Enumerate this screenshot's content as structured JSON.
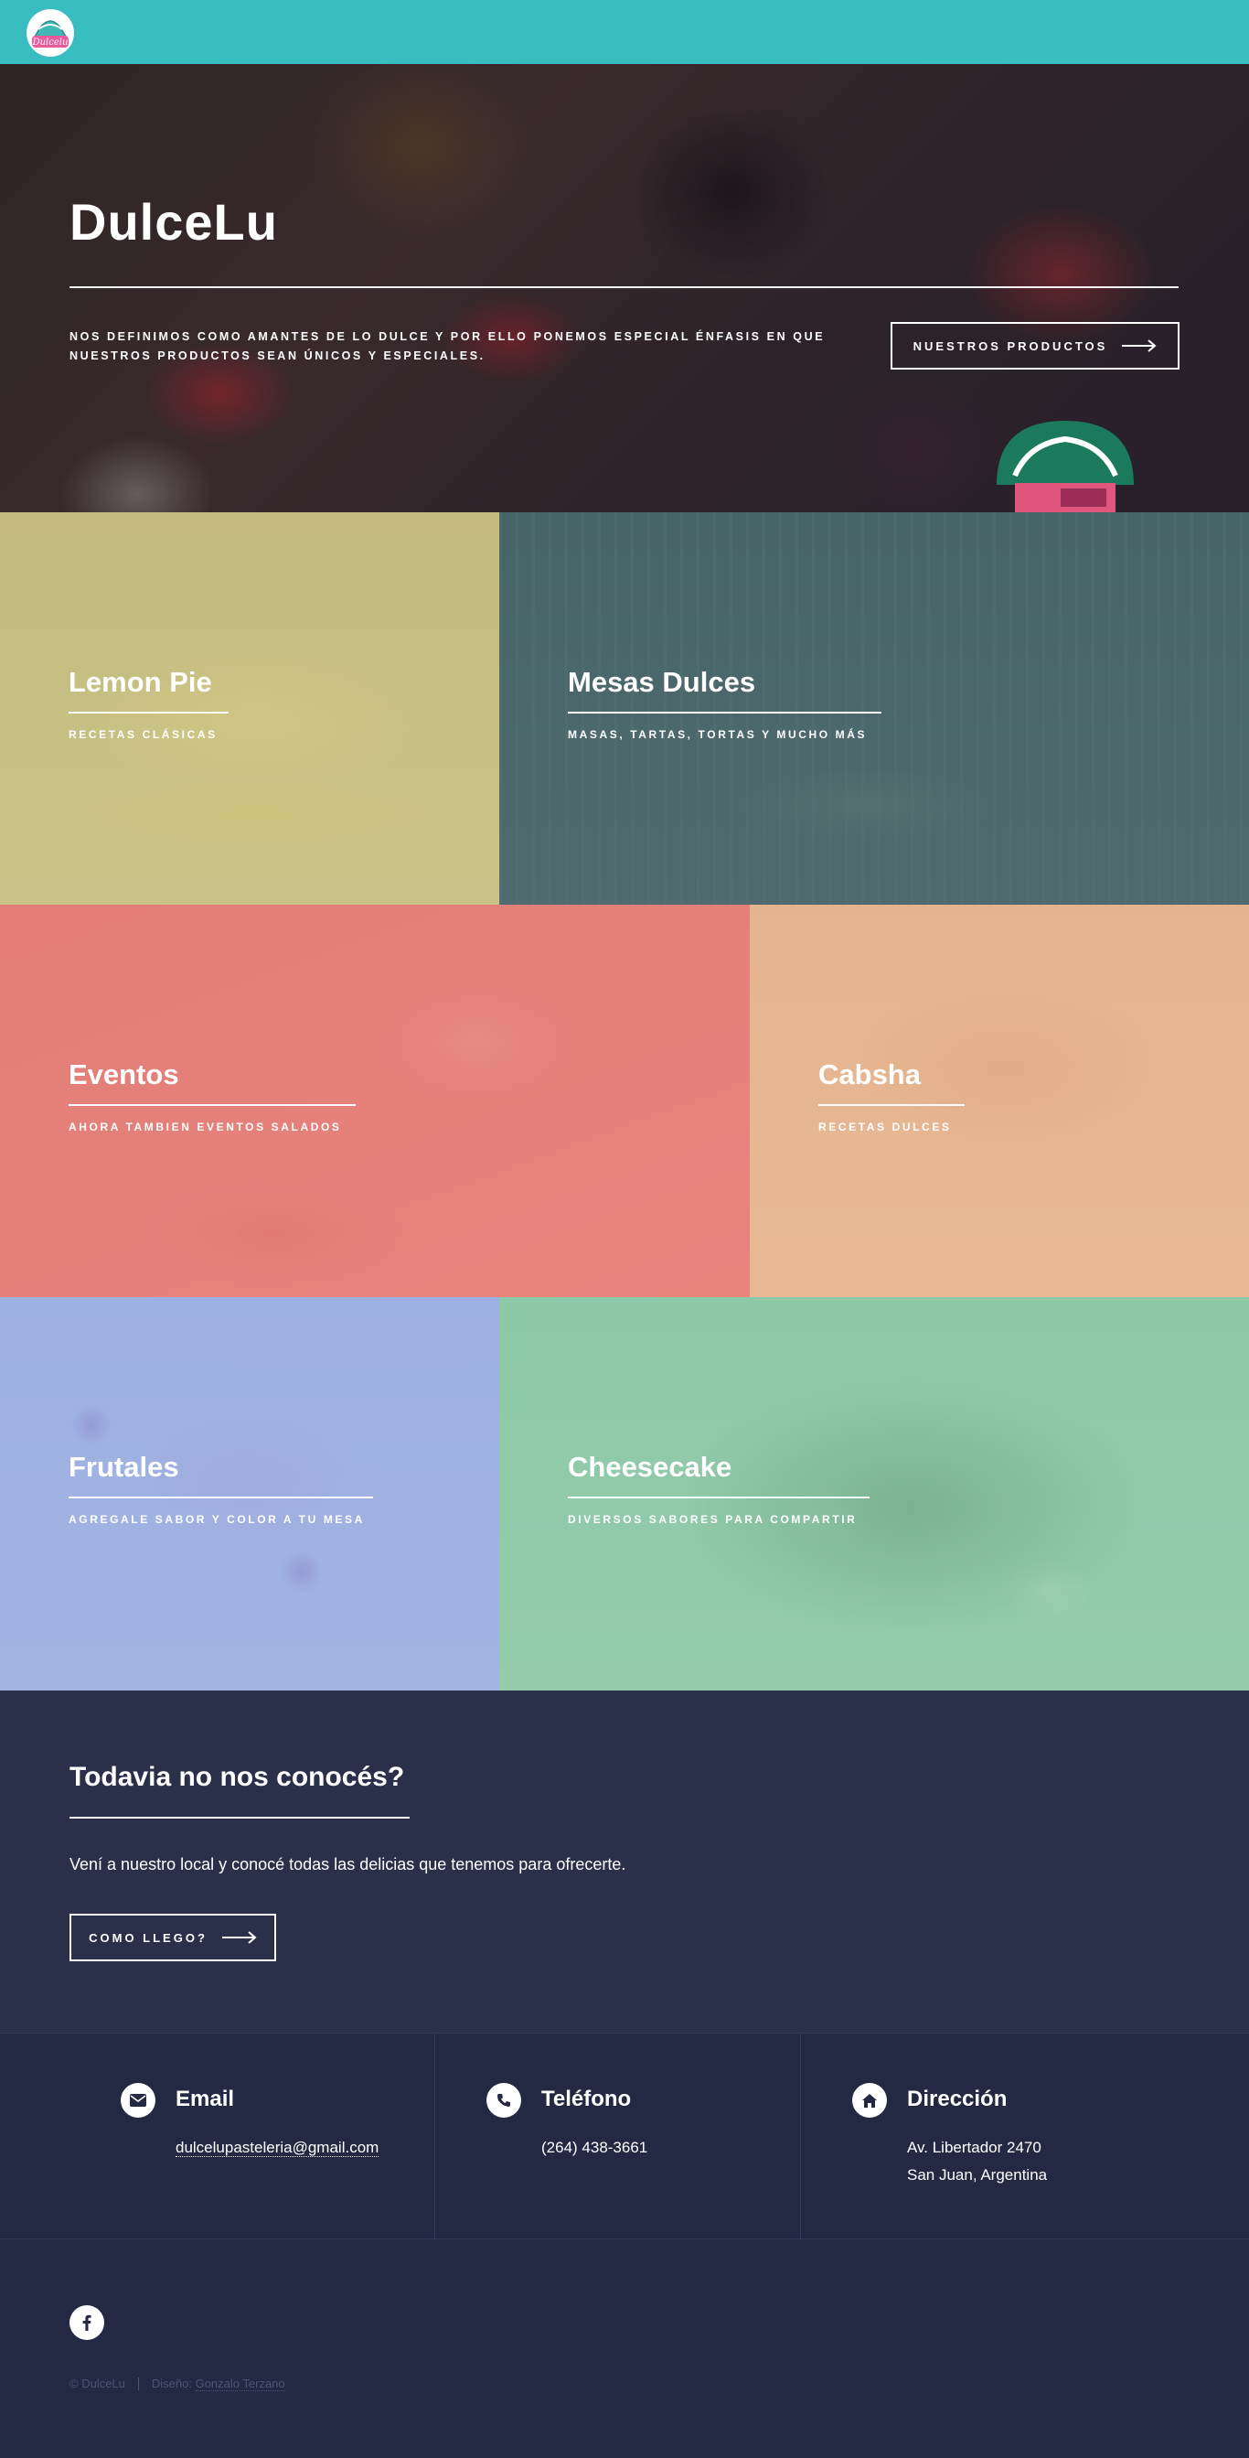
{
  "header": {
    "logo_text": "Dulcelu"
  },
  "banner": {
    "title": "DulceLu",
    "description": "NOS DEFINIMOS COMO AMANTES DE LO DULCE Y POR ELLO PONEMOS ESPECIAL ÉNFASIS EN QUE NUESTROS PRODUCTOS SEAN ÚNICOS Y ESPECIALES.",
    "button_label": "NUESTROS PRODUCTOS"
  },
  "tiles": [
    {
      "title": "Lemon Pie",
      "subtitle": "RECETAS CLÁSICAS",
      "color": "#c7c081"
    },
    {
      "title": "Mesas Dulces",
      "subtitle": "MASAS, TARTAS, TORTAS Y MUCHO MÁS",
      "color": "#4b6a6f"
    },
    {
      "title": "Eventos",
      "subtitle": "AHORA TAMBIEN EVENTOS SALADOS",
      "color": "#e5807a"
    },
    {
      "title": "Cabsha",
      "subtitle": "RECETAS DULCES",
      "color": "#e6b48f"
    },
    {
      "title": "Frutales",
      "subtitle": "AGREGALE SABOR Y COLOR A TU MESA",
      "color": "#9aaee0"
    },
    {
      "title": "Cheesecake",
      "subtitle": "DIVERSOS SABORES PARA COMPARTIR",
      "color": "#8dc9a7"
    }
  ],
  "cta": {
    "title": "Todavia no nos conocés?",
    "text": "Vení a nuestro local y conocé todas las delicias que tenemos para ofrecerte.",
    "button_label": "COMO LLEGO?"
  },
  "contact": {
    "email": {
      "label": "Email",
      "value": "dulcelupasteleria@gmail.com",
      "icon": "envelope-icon"
    },
    "phone": {
      "label": "Teléfono",
      "value": "(264) 438-3661",
      "icon": "phone-icon"
    },
    "address": {
      "label": "Dirección",
      "line1": "Av. Libertador 2470",
      "line2": "San Juan, Argentina",
      "icon": "home-icon"
    }
  },
  "footer": {
    "social_icon": "facebook-icon",
    "copyright": "© DulceLu",
    "design_label": "Diseño:",
    "designer": "Gonzalo Terzano"
  }
}
